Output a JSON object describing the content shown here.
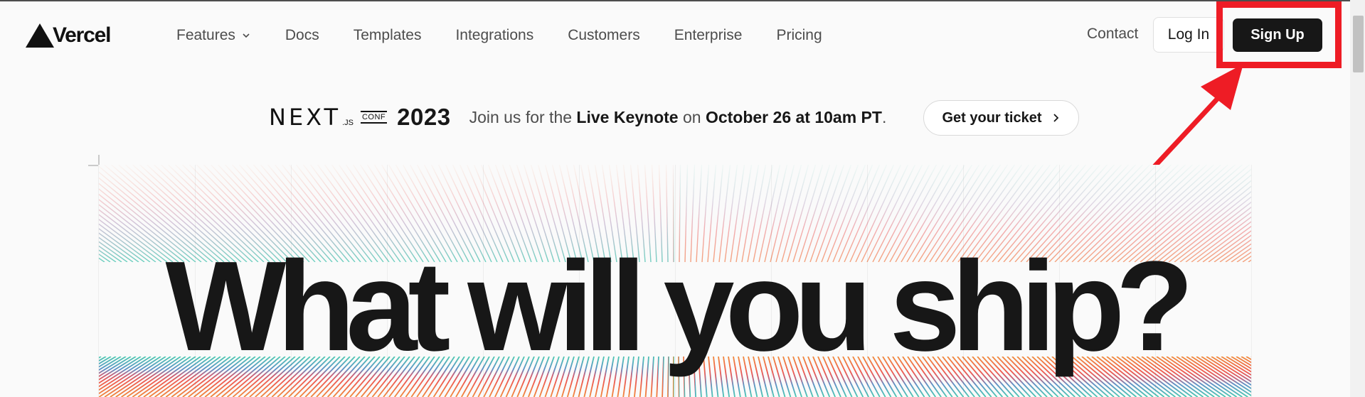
{
  "brand": {
    "name": "Vercel"
  },
  "nav": {
    "items": [
      {
        "label": "Features",
        "has_dropdown": true
      },
      {
        "label": "Docs"
      },
      {
        "label": "Templates"
      },
      {
        "label": "Integrations"
      },
      {
        "label": "Customers"
      },
      {
        "label": "Enterprise"
      },
      {
        "label": "Pricing"
      }
    ]
  },
  "header_actions": {
    "contact": "Contact",
    "login": "Log In",
    "signup": "Sign Up"
  },
  "announcement": {
    "logo_word": "NEXT",
    "logo_suffix": ".JS",
    "conf": "CONF",
    "year": "2023",
    "text_1": "Join us for the ",
    "bold_1": "Live Keynote",
    "text_2": " on ",
    "bold_2": "October 26 at 10am PT",
    "text_3": ".",
    "cta": "Get your ticket"
  },
  "hero": {
    "headline": "What will you ship?"
  },
  "annotation": {
    "color": "#ee1c25"
  },
  "colors": {
    "text": "#171717",
    "muted": "#4d4d4d",
    "background": "#fafafa"
  }
}
